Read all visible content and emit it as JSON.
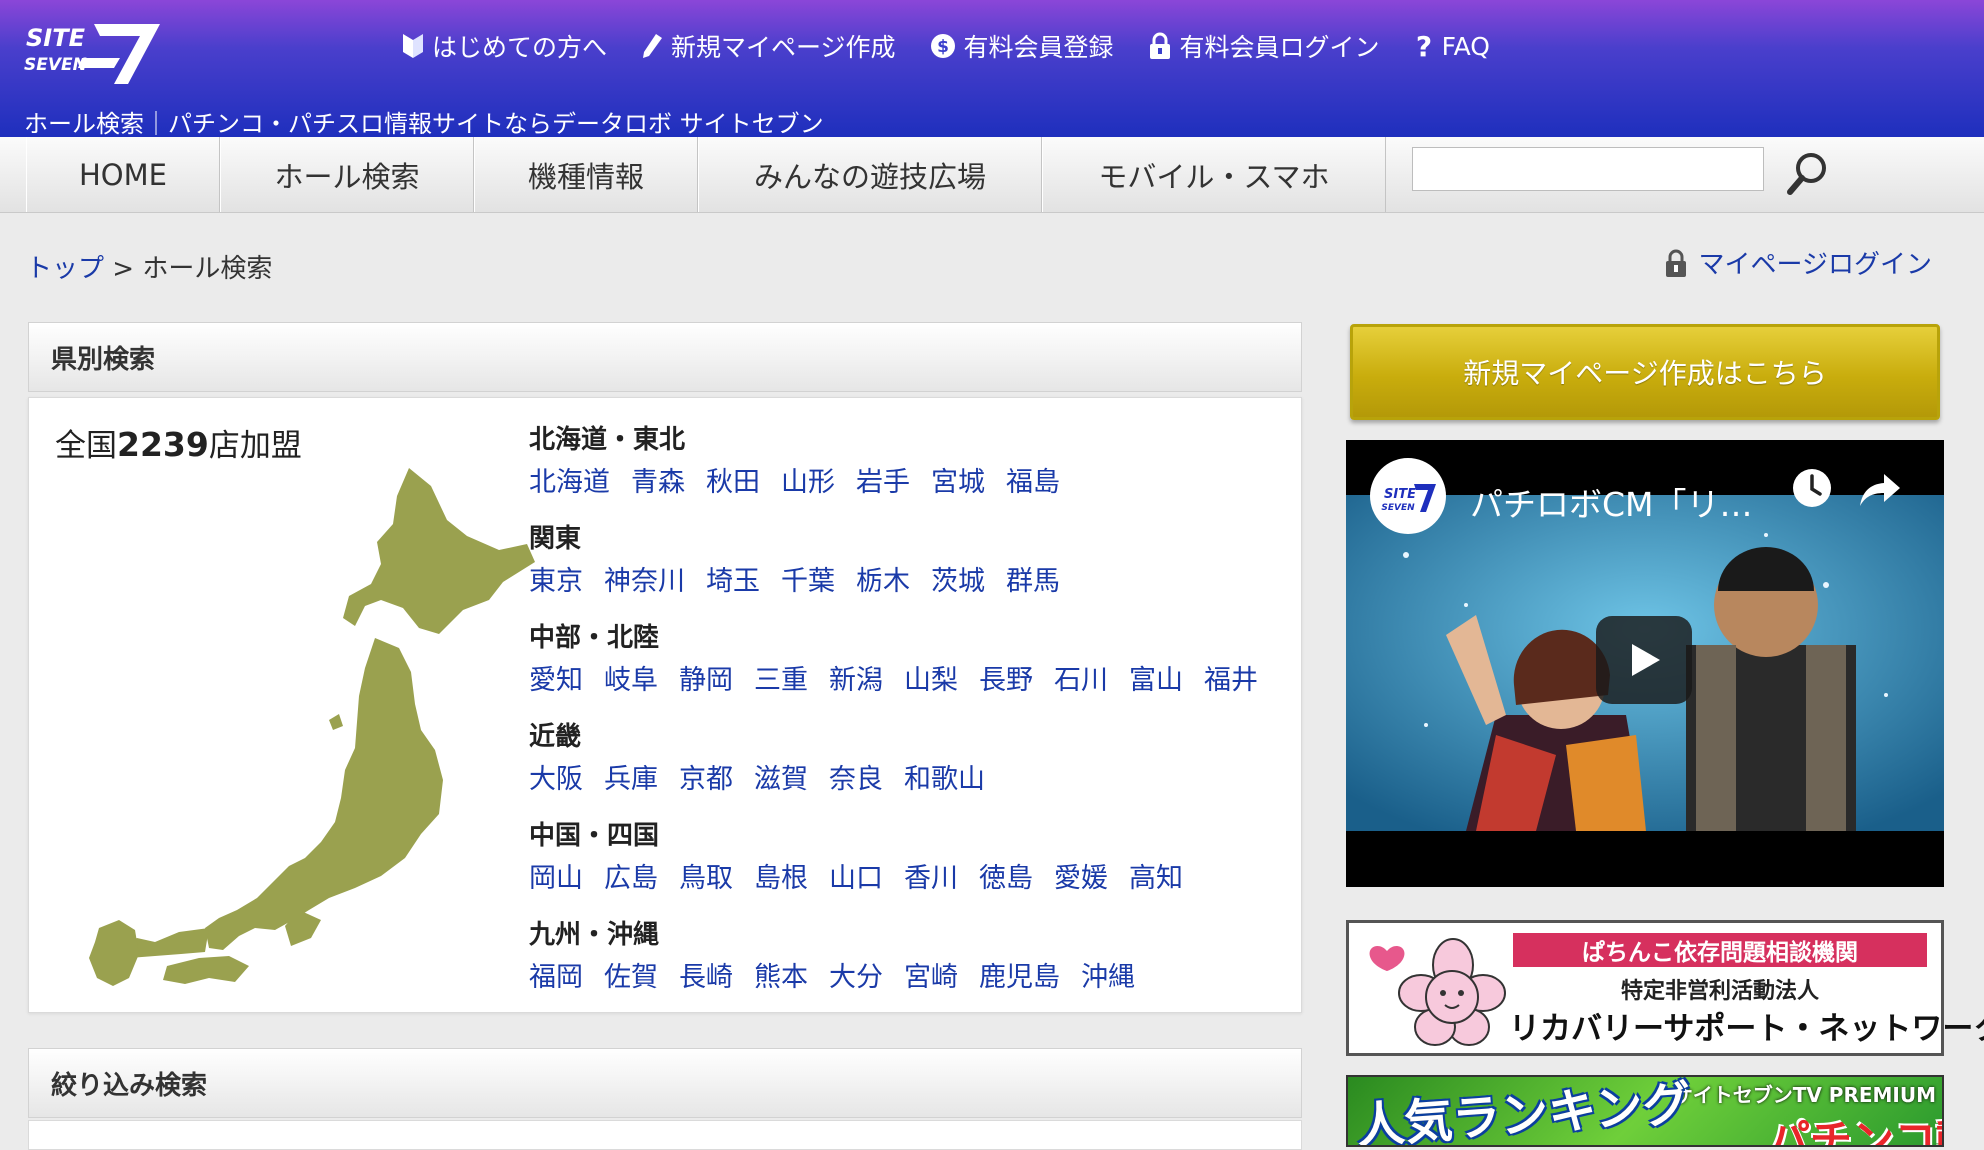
{
  "header": {
    "logo_text": "SITE SEVEN 7",
    "nav": [
      {
        "label": "はじめての方へ",
        "icon": "beginner-mark-icon"
      },
      {
        "label": "新規マイページ作成",
        "icon": "pen-icon"
      },
      {
        "label": "有料会員登録",
        "icon": "dollar-icon"
      },
      {
        "label": "有料会員ログイン",
        "icon": "lock-icon"
      },
      {
        "label": "FAQ",
        "icon": "question-icon"
      }
    ],
    "tagline": "ホール検索｜パチンコ・パチスロ情報サイトならデータロボ サイトセブン"
  },
  "menu": {
    "items": [
      "HOME",
      "ホール検索",
      "機種情報",
      "みんなの遊技広場",
      "モバイル・スマホ"
    ],
    "search_placeholder": "",
    "search_icon": "search-icon"
  },
  "breadcrumb": {
    "top": "トップ",
    "separator": " > ",
    "current": "ホール検索"
  },
  "mypage_login": "マイページログイン",
  "prefecture_search": {
    "title": "県別検索",
    "count_prefix": "全国",
    "count_value": "2239",
    "count_suffix": "店加盟",
    "regions": [
      {
        "name": "北海道・東北",
        "prefs": [
          "北海道",
          "青森",
          "秋田",
          "山形",
          "岩手",
          "宮城",
          "福島"
        ]
      },
      {
        "name": "関東",
        "prefs": [
          "東京",
          "神奈川",
          "埼玉",
          "千葉",
          "栃木",
          "茨城",
          "群馬"
        ]
      },
      {
        "name": "中部・北陸",
        "prefs": [
          "愛知",
          "岐阜",
          "静岡",
          "三重",
          "新潟",
          "山梨",
          "長野",
          "石川",
          "富山",
          "福井"
        ]
      },
      {
        "name": "近畿",
        "prefs": [
          "大阪",
          "兵庫",
          "京都",
          "滋賀",
          "奈良",
          "和歌山"
        ]
      },
      {
        "name": "中国・四国",
        "prefs": [
          "岡山",
          "広島",
          "鳥取",
          "島根",
          "山口",
          "香川",
          "徳島",
          "愛媛",
          "高知"
        ]
      },
      {
        "name": "九州・沖縄",
        "prefs": [
          "福岡",
          "佐賀",
          "長崎",
          "熊本",
          "大分",
          "宮崎",
          "鹿児島",
          "沖縄"
        ]
      }
    ]
  },
  "filter_search": {
    "title": "絞り込み検索"
  },
  "sidebar": {
    "cta_label": "新規マイページ作成はこちら",
    "video_title": "パチロボCM「リ…",
    "video_channel_logo": "SITE SEVEN TV",
    "banner1": {
      "top": "ぱちんこ依存問題相談機関",
      "mid": "特定非営利活動法人",
      "main": "リカバリーサポート・ネットワーク"
    },
    "banner2": {
      "sub": "サイトセブンTV PREMIUM",
      "main": "人気ランキング",
      "cut": "パチンコ動画!"
    }
  },
  "colors": {
    "header_top": "#8b46d8",
    "header_bottom": "#1e2fbd",
    "link": "#1a3aa8",
    "map_green": "#9aa14f",
    "cta_gold": "#c9ad0d"
  }
}
